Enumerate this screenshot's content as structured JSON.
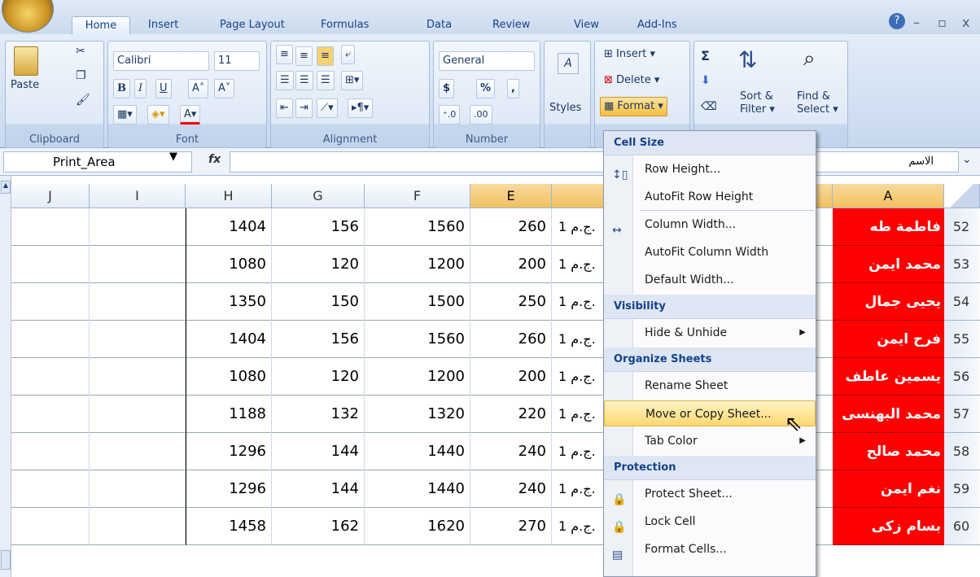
{
  "ribbon_tabs": [
    "Home",
    "Insert",
    "Page Layout",
    "Formulas",
    "Data",
    "Review",
    "View",
    "Add-Ins"
  ],
  "window_controls": {
    "help": "?",
    "min": "–",
    "restore": "▫",
    "close": "x"
  },
  "clipboard": {
    "paste": "Paste",
    "caption": "Clipboard"
  },
  "font": {
    "name": "Calibri",
    "size": "11",
    "caption": "Font",
    "bold": "B",
    "italic": "I",
    "underline": "U"
  },
  "alignment": {
    "caption": "Alignment"
  },
  "number": {
    "format": "General",
    "currency": "$",
    "percent": "%",
    "comma": ",",
    "caption": "Number"
  },
  "styles": {
    "label": "Styles"
  },
  "cells": {
    "insert": "Insert",
    "delete": "Delete",
    "format": "Format"
  },
  "editing": {
    "sigma": "Σ",
    "sort": "Sort &",
    "filter": "Filter",
    "find": "Find &",
    "select": "Select"
  },
  "formula_bar": {
    "name_box": "Print_Area",
    "fx": "fx",
    "value": "الاسم"
  },
  "columns": [
    "J",
    "I",
    "H",
    "G",
    "F",
    "E",
    "",
    "",
    "A"
  ],
  "rows": [
    {
      "num": "52",
      "H": "1404",
      "G": "156",
      "F": "1560",
      "E": "260",
      "D": "1 ج.م.",
      "name": "فاطمة طه"
    },
    {
      "num": "53",
      "H": "1080",
      "G": "120",
      "F": "1200",
      "E": "200",
      "D": "1 ج.م.",
      "name": "محمد ايمن"
    },
    {
      "num": "54",
      "H": "1350",
      "G": "150",
      "F": "1500",
      "E": "250",
      "D": "1 ج.م.",
      "name": "يحيى جمال"
    },
    {
      "num": "55",
      "H": "1404",
      "G": "156",
      "F": "1560",
      "E": "260",
      "D": "1 ج.م.",
      "name": "فرح ايمن"
    },
    {
      "num": "56",
      "H": "1080",
      "G": "120",
      "F": "1200",
      "E": "200",
      "D": "1 ج.م.",
      "name": "يسمين عاطف"
    },
    {
      "num": "57",
      "H": "1188",
      "G": "132",
      "F": "1320",
      "E": "220",
      "D": "1 ج.م.",
      "name": "محمد البهنسى"
    },
    {
      "num": "58",
      "H": "1296",
      "G": "144",
      "F": "1440",
      "E": "240",
      "D": "1 ج.م.",
      "name": "محمد صالح"
    },
    {
      "num": "59",
      "H": "1296",
      "G": "144",
      "F": "1440",
      "E": "240",
      "D": "1 ج.م.",
      "name": "نغم ايمن"
    },
    {
      "num": "60",
      "H": "1458",
      "G": "162",
      "F": "1620",
      "E": "270",
      "D": "1 ج.م.",
      "name": "بسام زكى"
    }
  ],
  "format_menu": {
    "sections": [
      {
        "title": "Cell Size",
        "items": [
          {
            "label": "Row Height...",
            "icon": "row-height-icon"
          },
          {
            "label": "AutoFit Row Height",
            "icon": ""
          },
          {
            "label": "Column Width...",
            "icon": "column-width-icon"
          },
          {
            "label": "AutoFit Column Width",
            "icon": ""
          },
          {
            "label": "Default Width...",
            "icon": ""
          }
        ]
      },
      {
        "title": "Visibility",
        "items": [
          {
            "label": "Hide & Unhide",
            "icon": "",
            "submenu": true
          }
        ]
      },
      {
        "title": "Organize Sheets",
        "items": [
          {
            "label": "Rename Sheet",
            "icon": ""
          },
          {
            "label": "Move or Copy Sheet...",
            "icon": "",
            "hot": true
          },
          {
            "label": "Tab Color",
            "icon": "",
            "submenu": true
          }
        ]
      },
      {
        "title": "Protection",
        "items": [
          {
            "label": "Protect Sheet...",
            "icon": "protect-sheet-icon"
          },
          {
            "label": "Lock Cell",
            "icon": "lock-cell-icon"
          },
          {
            "label": "Format Cells...",
            "icon": "format-cells-icon"
          }
        ]
      }
    ]
  }
}
